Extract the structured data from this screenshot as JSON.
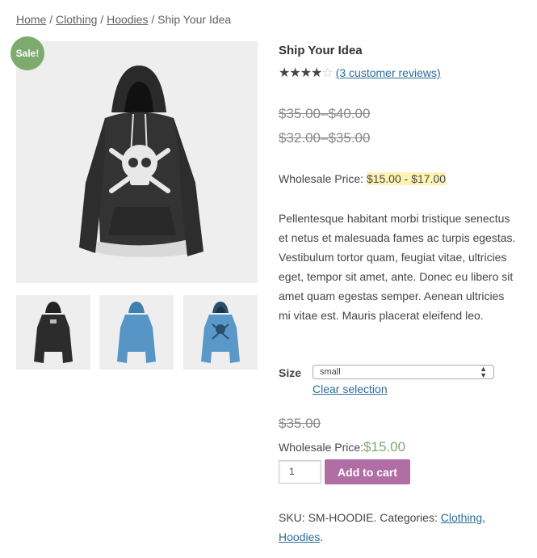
{
  "breadcrumb": {
    "home": "Home",
    "sep1": " / ",
    "clothing": "Clothing",
    "sep2": " / ",
    "hoodies": "Hoodies",
    "sep3": " / ",
    "current": "Ship Your Idea"
  },
  "badge": {
    "sale": "Sale!"
  },
  "product": {
    "title": "Ship Your Idea",
    "rating": 4,
    "rating_max": 5,
    "reviews_link": "(3 customer reviews)",
    "price_range_1": "$35.00–$40.00",
    "price_range_2": "$32.00–$35.00",
    "wholesale_label": "Wholesale Price: ",
    "wholesale_range": "$15.00 - $17.00",
    "description": "Pellentesque habitant morbi tristique senectus et netus et malesuada fames ac turpis egestas. Vestibulum tortor quam, feugiat vitae, ultricies eget, tempor sit amet, ante. Donec eu libero sit amet quam egestas semper. Aenean ultricies mi vitae est. Mauris placerat eleifend leo."
  },
  "variation": {
    "size_label": "Size",
    "size_selected": "small",
    "clear_link": "Clear selection",
    "price": "$35.00",
    "wholesale_label": "Wholesale Price:",
    "wholesale_amount": "$15.00"
  },
  "cart": {
    "quantity": "1",
    "add_button": "Add to cart"
  },
  "meta": {
    "sku_label": "SKU: ",
    "sku": "SM-HOODIE",
    "categories_label": ". Categories: ",
    "cat1": "Clothing",
    "sep": ", ",
    "cat2": "Hoodies",
    "end": "."
  },
  "colors": {
    "sale_badge": "#7faa6e",
    "add_to_cart": "#b06ea5",
    "highlight": "#fff3b3",
    "link": "#2c6c9a"
  },
  "images": {
    "main": "black-hoodie-skull-icon",
    "thumbs": [
      "black-hoodie-back-icon",
      "blue-hoodie-back-icon",
      "blue-hoodie-front-icon"
    ]
  }
}
